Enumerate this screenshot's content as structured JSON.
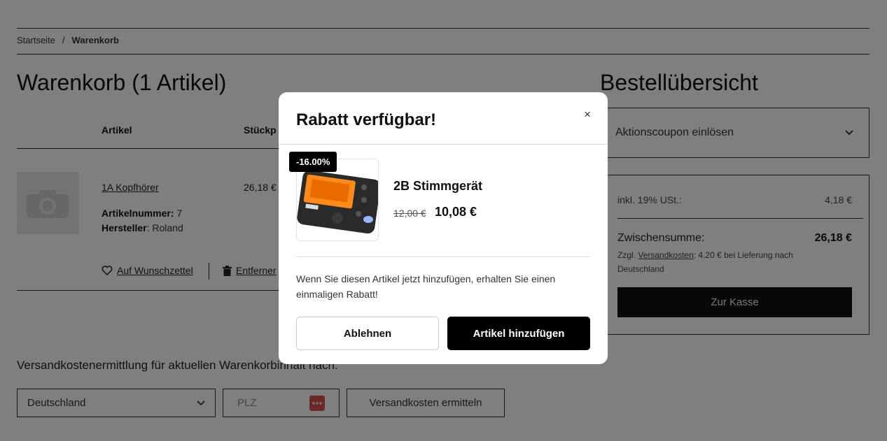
{
  "breadcrumb": {
    "home": "Startseite",
    "separator": "/",
    "current": "Warenkorb"
  },
  "cart": {
    "title": "Warenkorb (1 Artikel)",
    "columns": {
      "article": "Artikel",
      "unit_price": "Stückp"
    },
    "item": {
      "name": "1A Kopfhörer",
      "article_number_label": "Artikelnummer:",
      "article_number": "7",
      "manufacturer_label": "Hersteller",
      "manufacturer": "Roland",
      "price": "26,18 €",
      "wishlist_label": "Auf Wunschzettel",
      "remove_label": "Entferner"
    }
  },
  "shipping": {
    "title": "Versandkostenermittlung für aktuellen Warenkorbinhalt nach:",
    "country": "Deutschland",
    "zip_placeholder": "PLZ",
    "button_label": "Versandkosten ermitteln"
  },
  "summary": {
    "title": "Bestellübersicht",
    "coupon_label": "Aktionscoupon einlösen",
    "vat_label": "inkl. 19% USt.:",
    "vat_value": "4,18 €",
    "subtotal_label": "Zwischensumme:",
    "subtotal_value": "26,18 €",
    "shipping_prefix": "Zzgl.",
    "shipping_link": "Versandkosten",
    "shipping_suffix": ": 4.20 € bei Lieferung nach Deutschland",
    "checkout_label": "Zur Kasse"
  },
  "modal": {
    "title": "Rabatt verfügbar!",
    "close_label": "×",
    "badge": "-16.00%",
    "product_name": "2B Stimmgerät",
    "old_price": "12,00 €",
    "new_price": "10,08 €",
    "text": "Wenn Sie diesen Artikel jetzt hinzufügen, erhalten Sie einen einmaligen Rabatt!",
    "decline_label": "Ablehnen",
    "add_label": "Artikel hinzufügen"
  },
  "colors": {
    "overlay": "#000000",
    "button_dark": "#000000",
    "badge_bg": "#000000",
    "password_icon": "#d9534f"
  }
}
